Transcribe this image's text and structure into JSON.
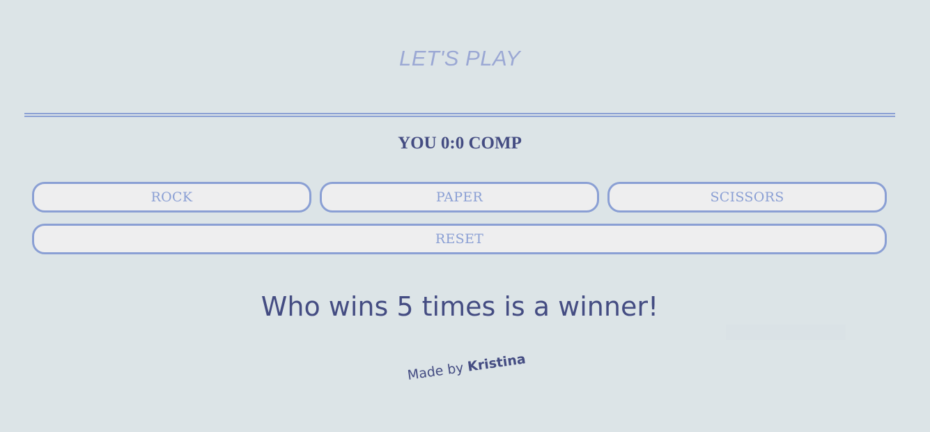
{
  "header": {
    "title": "LET'S PLAY"
  },
  "scoreboard": {
    "text": "YOU 0:0 COMP"
  },
  "controls": {
    "rock_label": "ROCK",
    "paper_label": "PAPER",
    "scissors_label": "SCISSORS",
    "reset_label": "RESET"
  },
  "message": {
    "text": "Who wins 5 times is a winner!"
  },
  "footer": {
    "prefix": "Made by ",
    "author": "Kristina"
  },
  "colors": {
    "background": "#dce4e7",
    "accent": "#8a9fd4",
    "text_dark": "#444c82",
    "button_fill": "#eeeeef"
  }
}
